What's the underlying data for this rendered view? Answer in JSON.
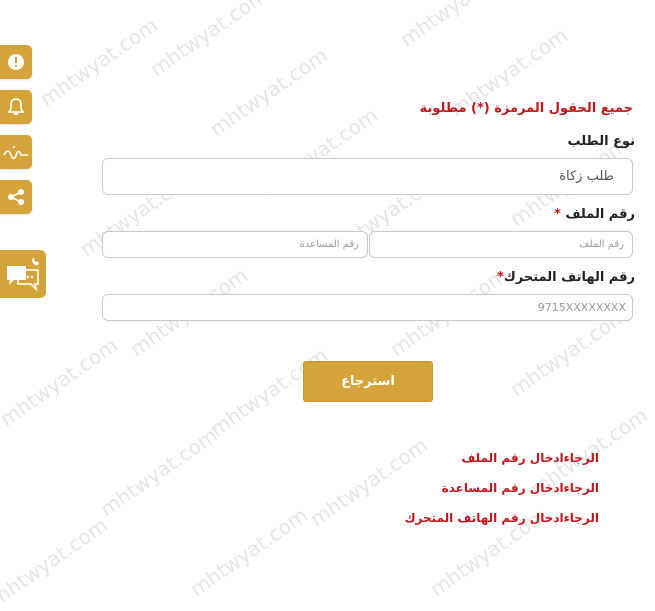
{
  "watermark": "mhtwyat.com",
  "sidebar": {
    "items": [
      {
        "icon": "alert-icon"
      },
      {
        "icon": "bell-icon"
      },
      {
        "icon": "signature-icon"
      },
      {
        "icon": "share-icon"
      }
    ],
    "chat_icon": "chat-phone-icon"
  },
  "form": {
    "required_note": "جميع الحقول المرمزة (*) مطلوبة",
    "request_type_label": "نوع الطلب",
    "request_type_value": "طلب زكاة",
    "file_number_label": "رقم الملف",
    "file_number_placeholder": "رقم الملف",
    "help_number_placeholder": "رقم المساعدة",
    "mobile_label": "رقم الهاتف المتحرك",
    "mobile_placeholder": "9715XXXXXXXX",
    "required_mark": "*",
    "submit_label": "استرجاع"
  },
  "errors": [
    "الرجاءادخال رقم الملف",
    "الرجاءادخال رقم المساعدة",
    "الرجاءادخال رقم الهاتف المتحرك"
  ],
  "colors": {
    "accent": "#d4a43a",
    "error": "#c0161c"
  }
}
